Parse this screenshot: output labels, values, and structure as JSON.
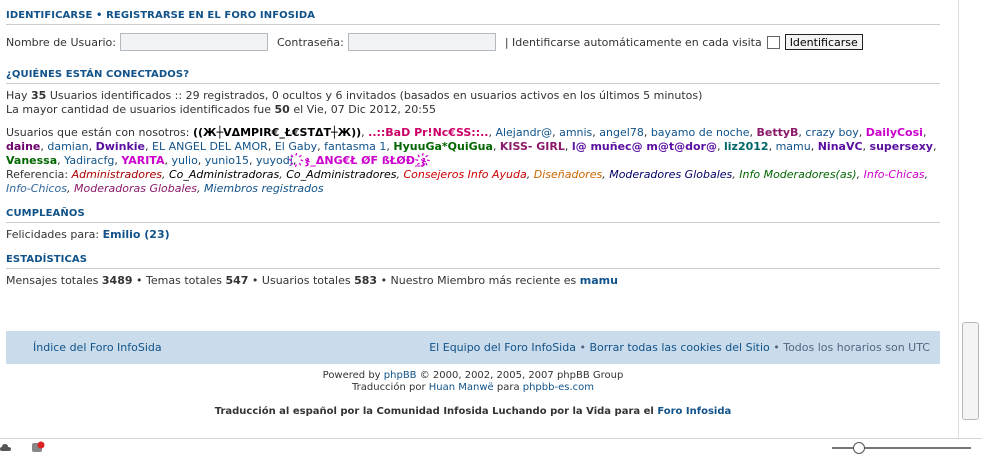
{
  "login": {
    "title": "IDENTIFICARSE • REGISTRARSE EN EL FORO INFOSIDA",
    "title_identify": "IDENTIFICARSE",
    "title_sep": " • ",
    "title_register": "REGISTRARSE EN EL FORO INFOSIDA",
    "username_label": "Nombre de Usuario:",
    "password_label": "Contraseña:",
    "autologin_label": "| Identificarse automáticamente en cada visita",
    "submit_label": "Identificarse"
  },
  "online": {
    "title": "¿QUIÉNES ESTÁN CONECTADOS?",
    "line1_pre": "Hay ",
    "line1_count": "35",
    "line1_post": " Usuarios identificados :: 29 registrados, 0 ocultos y 6 invitados (basados en usuarios activos en los últimos 5 minutos)",
    "line2_pre": "La mayor cantidad de usuarios identificados fue ",
    "line2_count": "50",
    "line2_post": " el Vie, 07 Dic 2012, 20:55",
    "users_label": "Usuarios que están con nosotros: ",
    "users": [
      {
        "name": "((Ж┼VΔMPIR€_Ł€STΔT┼Ж))",
        "color": "#000000",
        "bold": true
      },
      {
        "name": "..::BaD Pr!Nc€SS::..",
        "color": "#cc0066",
        "bold": true
      },
      {
        "name": "Alejandr@",
        "color": "#105289",
        "bold": false
      },
      {
        "name": "amnis",
        "color": "#105289",
        "bold": false
      },
      {
        "name": "angel78",
        "color": "#105289",
        "bold": false
      },
      {
        "name": "bayamo de noche",
        "color": "#105289",
        "bold": false
      },
      {
        "name": "BettyB",
        "color": "#8b1a6b",
        "bold": true
      },
      {
        "name": "crazy boy",
        "color": "#105289",
        "bold": false
      },
      {
        "name": "DailyCosi",
        "color": "#cc00cc",
        "bold": true
      },
      {
        "name": "daine",
        "color": "#6b006b",
        "bold": true
      },
      {
        "name": "damian",
        "color": "#105289",
        "bold": false
      },
      {
        "name": "Dwinkie",
        "color": "#5a0fa0",
        "bold": true
      },
      {
        "name": "EL ANGEL DEL AMOR",
        "color": "#105289",
        "bold": false
      },
      {
        "name": "El Gaby",
        "color": "#105289",
        "bold": false
      },
      {
        "name": "fantasma 1",
        "color": "#105289",
        "bold": false
      },
      {
        "name": "HyuuGa*QuiGua",
        "color": "#006600",
        "bold": true
      },
      {
        "name": "KISS- GIRL",
        "color": "#8b1a6b",
        "bold": true
      },
      {
        "name": "l@ muñec@ m@t@dor@",
        "color": "#5a0fa0",
        "bold": true
      },
      {
        "name": "liz2012",
        "color": "#006666",
        "bold": true
      },
      {
        "name": "mamu",
        "color": "#105289",
        "bold": false
      },
      {
        "name": "NinaVC",
        "color": "#5a0fa0",
        "bold": true
      },
      {
        "name": "supersexy",
        "color": "#5a0fa0",
        "bold": true
      },
      {
        "name": "Vanessa",
        "color": "#006600",
        "bold": true
      },
      {
        "name": "Yadiracfg",
        "color": "#105289",
        "bold": false
      },
      {
        "name": "YARITA",
        "color": "#cc00cc",
        "bold": true
      },
      {
        "name": "yulio",
        "color": "#105289",
        "bold": false
      },
      {
        "name": "yunio15",
        "color": "#105289",
        "bold": false
      },
      {
        "name": "yuyodj",
        "color": "#105289",
        "bold": false
      },
      {
        "name": "҉ჯ_ΔNG€Ł ØF ßŁØĐ_ჯ҉",
        "color": "#cc00cc",
        "bold": true
      }
    ],
    "legend_label": "Referencia: ",
    "legend": [
      {
        "name": "Administradores",
        "color": "#aa0000"
      },
      {
        "name": "Co_Administradoras",
        "color": "#000000"
      },
      {
        "name": "Co_Administradores",
        "color": "#000000"
      },
      {
        "name": "Consejeros Info Ayuda",
        "color": "#cc0000"
      },
      {
        "name": "Diseñadores",
        "color": "#cc6600"
      },
      {
        "name": "Moderadores Globales",
        "color": "#000066"
      },
      {
        "name": "Info Moderadores(as)",
        "color": "#006600"
      },
      {
        "name": "Info-Chicas",
        "color": "#cc00cc"
      },
      {
        "name": "Info-Chicos",
        "color": "#336699"
      },
      {
        "name": "Moderadoras Globales",
        "color": "#8b1a6b"
      },
      {
        "name": "Miembros registrados",
        "color": "#105289"
      }
    ]
  },
  "birthdays": {
    "title": "CUMPLEAÑOS",
    "label": "Felicidades para: ",
    "user": "Emilio (23)"
  },
  "stats": {
    "title": "ESTADÍSTICAS",
    "messages_label": "Mensajes totales ",
    "messages": "3489",
    "topics_label": " • Temas totales ",
    "topics": "547",
    "users_label": " • Usuarios totales ",
    "users": "583",
    "newest_label": " • Nuestro Miembro más reciente es ",
    "newest": "mamu"
  },
  "footer": {
    "index_link": "Índice del Foro InfoSida",
    "team_link": "El Equipo del Foro InfoSida",
    "sep": " • ",
    "cookies_link": "Borrar todas las cookies del Sitio",
    "timezone": " • Todos los horarios son UTC"
  },
  "credits": {
    "powered_pre": "Powered by ",
    "phpbb": "phpBB",
    "powered_post": " © 2000, 2002, 2005, 2007 phpBB Group",
    "translation_pre": "Traducción por ",
    "translator": "Huan Manwë",
    "translation_mid": " para ",
    "translation_site": "phpbb-es.com",
    "community_pre": "Traducción al español por la Comunidad Infosida Luchando por la Vida para el ",
    "community_link": "Foro Infosida"
  },
  "status_icons": [
    "cloud-icon",
    "shield-alert-icon"
  ],
  "zoom_slider": {
    "level": 0.19
  }
}
